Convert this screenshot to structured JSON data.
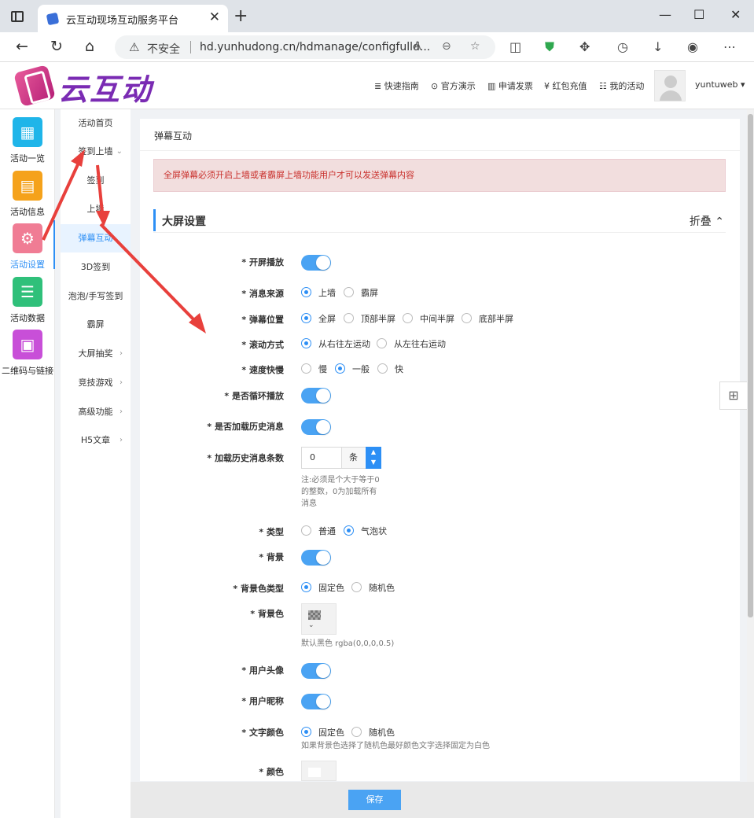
{
  "browser": {
    "tab_title": "云互动现场互动服务平台",
    "security_label": "不安全",
    "url": "hd.yunhudong.cn/hdmanage/configfulld...",
    "new_tab_glyph": "+",
    "close_glyph": "✕"
  },
  "header": {
    "logo_text": "云互动",
    "nav": [
      {
        "icon": "≣",
        "label": "快速指南"
      },
      {
        "icon": "⊙",
        "label": "官方演示"
      },
      {
        "icon": "▥",
        "label": "申请发票"
      },
      {
        "icon": "¥",
        "label": "红包充值"
      },
      {
        "icon": "☷",
        "label": "我的活动"
      }
    ],
    "username": "yuntuweb",
    "user_caret": "▾"
  },
  "icon_nav": [
    {
      "label": "活动一览",
      "color": "#1fb5e9",
      "glyph": "▦"
    },
    {
      "label": "活动信息",
      "color": "#f5a21b",
      "glyph": "▤"
    },
    {
      "label": "活动设置",
      "color": "#f07c94",
      "glyph": "⚙"
    },
    {
      "label": "活动数据",
      "color": "#2fc07a",
      "glyph": "☰"
    },
    {
      "label": "二维码与链接",
      "color": "#c84fd8",
      "glyph": "▣"
    }
  ],
  "sub_nav": [
    {
      "label": "活动首页",
      "arrow": ""
    },
    {
      "label": "签到上墙",
      "arrow": "⌄"
    },
    {
      "label": "签到",
      "arrow": ""
    },
    {
      "label": "上墙",
      "arrow": ""
    },
    {
      "label": "弹幕互动",
      "arrow": ""
    },
    {
      "label": "3D签到",
      "arrow": ""
    },
    {
      "label": "泡泡/手写签到",
      "arrow": ""
    },
    {
      "label": "霸屏",
      "arrow": ""
    },
    {
      "label": "大屏抽奖",
      "arrow": "›"
    },
    {
      "label": "竞技游戏",
      "arrow": "›"
    },
    {
      "label": "高级功能",
      "arrow": "›"
    },
    {
      "label": "H5文章",
      "arrow": "›"
    }
  ],
  "panel": {
    "title": "弹幕互动",
    "alert": "全屏弹幕必须开启上墙或者霸屏上墙功能用户才可以发送弹幕内容",
    "section_title": "大屏设置",
    "collapse_label": "折叠 ⌃"
  },
  "form": {
    "open_play": {
      "label": "* 开屏播放",
      "on": true
    },
    "msg_source": {
      "label": "* 消息来源",
      "options": [
        "上墙",
        "霸屏"
      ],
      "selected": 0
    },
    "position": {
      "label": "* 弹幕位置",
      "options": [
        "全屏",
        "顶部半屏",
        "中间半屏",
        "底部半屏"
      ],
      "selected": 0
    },
    "scroll_mode": {
      "label": "* 滚动方式",
      "options": [
        "从右往左运动",
        "从左往右运动"
      ],
      "selected": 0
    },
    "speed": {
      "label": "* 速度快慢",
      "options": [
        "慢",
        "一般",
        "快"
      ],
      "selected": 1
    },
    "loop": {
      "label": "* 是否循环播放",
      "on": true
    },
    "load_history": {
      "label": "* 是否加载历史消息",
      "on": true
    },
    "history_count": {
      "label": "* 加载历史消息条数",
      "value": "0",
      "unit": "条",
      "hint_lines": [
        "注:必须是个大于等于0",
        "的整数，0为加载所有",
        "消息"
      ]
    },
    "type": {
      "label": "* 类型",
      "options": [
        "普通",
        "气泡状"
      ],
      "selected": 1
    },
    "background": {
      "label": "* 背景",
      "on": true
    },
    "bg_color_type": {
      "label": "* 背景色类型",
      "options": [
        "固定色",
        "随机色"
      ],
      "selected": 0
    },
    "bg_color": {
      "label": "* 背景色",
      "hint": "默认黑色 rgba(0,0,0,0.5)",
      "caret": "⌄"
    },
    "user_avatar": {
      "label": "* 用户头像",
      "on": true
    },
    "user_nickname": {
      "label": "* 用户昵称",
      "on": true
    },
    "text_color": {
      "label": "* 文字颜色",
      "options": [
        "固定色",
        "随机色"
      ],
      "selected": 0,
      "hint": "如果背景色选择了随机色最好颜色文字选择固定为白色"
    },
    "color": {
      "label": "* 颜色"
    }
  },
  "save_label": "保存",
  "accent_color": "#2d8ff5",
  "annotation_color": "#e8403c"
}
